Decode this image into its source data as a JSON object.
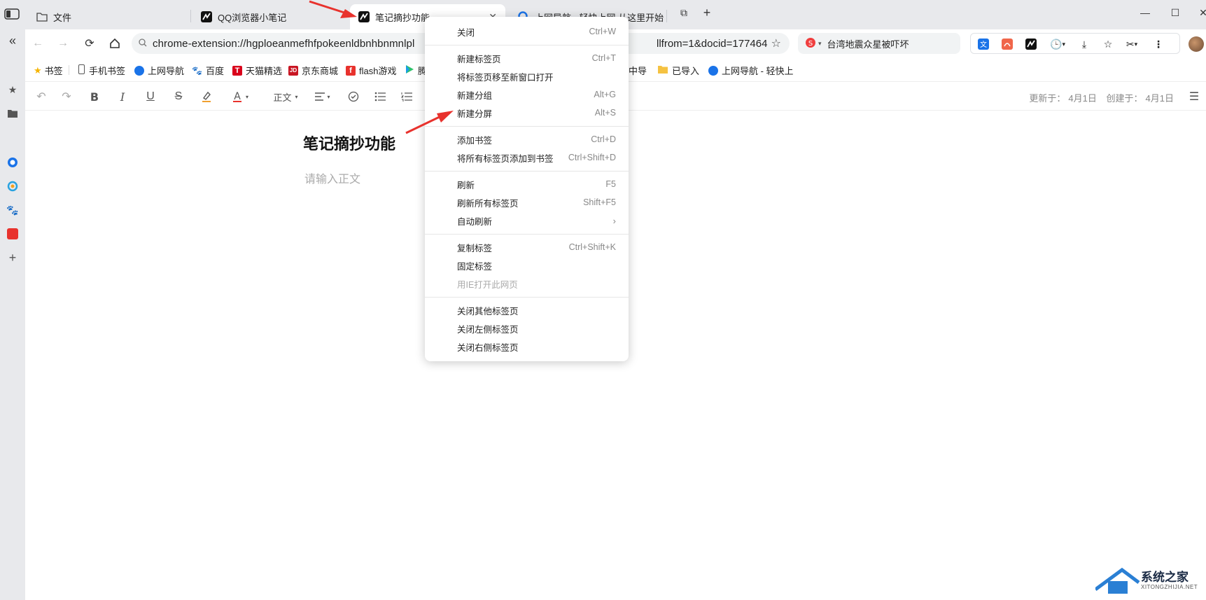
{
  "tabs": [
    {
      "label": "文件"
    },
    {
      "label": "QQ浏览器小笔记"
    },
    {
      "label": "笔记摘抄功能"
    },
    {
      "label": "上网导航 - 轻快上网 从这里开始"
    }
  ],
  "omnibox": {
    "url_start": "chrome-extension://hgploeanmefhfpokeenldbnhbnmnlpl",
    "url_end": "llfrom=1&docid=177464"
  },
  "search_pill": {
    "text": "台湾地震众星被吓坏"
  },
  "bookmarks": [
    {
      "label": "书签"
    },
    {
      "label": "手机书签"
    },
    {
      "label": "上网导航"
    },
    {
      "label": "百度"
    },
    {
      "label": "天猫精选"
    },
    {
      "label": "京东商城"
    },
    {
      "label": "flash游戏"
    },
    {
      "label": "腾"
    },
    {
      "label": "中导"
    },
    {
      "label": "已导入"
    },
    {
      "label": "上网导航 - 轻快上"
    }
  ],
  "editor": {
    "font_style": "正文",
    "updated_label": "更新于：",
    "updated_value": "4月1日",
    "created_label": "创建于：",
    "created_value": "4月1日"
  },
  "document": {
    "title": "笔记摘抄功能",
    "placeholder": "请输入正文"
  },
  "context_menu": {
    "items": [
      {
        "label": "关闭",
        "shortcut": "Ctrl+W"
      },
      {
        "label": "新建标签页",
        "shortcut": "Ctrl+T"
      },
      {
        "label": "将标签页移至新窗口打开",
        "shortcut": ""
      },
      {
        "label": "新建分组",
        "shortcut": "Alt+G"
      },
      {
        "label": "新建分屏",
        "shortcut": "Alt+S"
      },
      {
        "label": "添加书签",
        "shortcut": "Ctrl+D"
      },
      {
        "label": "将所有标签页添加到书签",
        "shortcut": "Ctrl+Shift+D"
      },
      {
        "label": "刷新",
        "shortcut": "F5"
      },
      {
        "label": "刷新所有标签页",
        "shortcut": "Shift+F5"
      },
      {
        "label": "自动刷新",
        "shortcut": ""
      },
      {
        "label": "复制标签",
        "shortcut": "Ctrl+Shift+K"
      },
      {
        "label": "固定标签",
        "shortcut": ""
      },
      {
        "label": "用IE打开此网页",
        "shortcut": ""
      },
      {
        "label": "关闭其他标签页",
        "shortcut": ""
      },
      {
        "label": "关闭左侧标签页",
        "shortcut": ""
      },
      {
        "label": "关闭右侧标签页",
        "shortcut": ""
      }
    ]
  },
  "watermark": {
    "text": "系统之家",
    "sub": "XITONGZHIJIA.NET"
  },
  "colors": {
    "annotation_arrow": "#e8322d",
    "accent": "#1a73e8"
  }
}
